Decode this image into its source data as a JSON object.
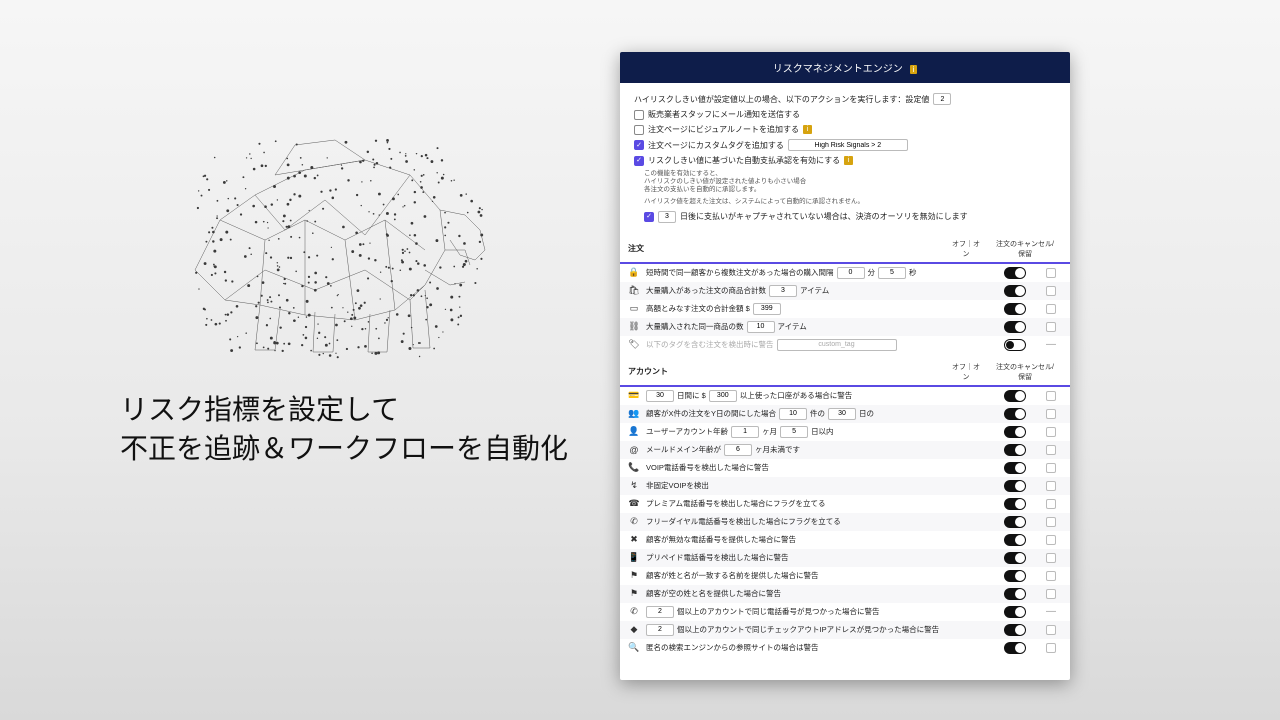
{
  "promo": {
    "line1": "リスク指標を設定して",
    "line2": "不正を追跡＆ワークフローを自動化"
  },
  "panel": {
    "title": "リスクマネジメントエンジン",
    "intro": {
      "threshold_prefix": "ハイリスクしきい値が設定値以上の場合、以下のアクションを実行します：設定値",
      "threshold_value": "2",
      "opt_mail": "販売業者スタッフにメール通知を送信する",
      "opt_visual": "注文ページにビジュアルノートを追加する",
      "opt_tag": "注文ページにカスタムタグを追加する",
      "tag_value": "High Risk Signals > 2",
      "opt_autopay": "リスクしきい値に基づいた自動支払承認を有効にする",
      "note1": "この機能を有効にすると、",
      "note2": "ハイリスクのしきい値が設定された値よりも小さい場合",
      "note3": "各注文の支払いを自動的に承認します。",
      "note4": "ハイリスク値を超えた注文は、システムによって自動的に承認されません。",
      "void_days": "3",
      "void_text": "日後に支払いがキャプチャされていない場合は、決済のオーソリを無効にします"
    },
    "sections": {
      "order": {
        "title": "注文",
        "col_toggle": "オフ｜オン",
        "col_cancel": "注文のキャンセル/保留"
      },
      "account": {
        "title": "アカウント",
        "col_toggle": "オフ｜オン",
        "col_cancel": "注文のキャンセル/保留"
      }
    },
    "order_rules": [
      {
        "ico": "🔒",
        "pre": "短時間で同一顧客から複数注文があった場合の購入間隔",
        "a": "0",
        "mid": "分",
        "b": "5",
        "post": "秒",
        "toggle": "on",
        "cancel": "box"
      },
      {
        "ico": "🛍",
        "pre": "大量購入があった注文の商品合計数",
        "a": "3",
        "post": "アイテム",
        "toggle": "on",
        "cancel": "box"
      },
      {
        "ico": "▭",
        "pre": "高額とみなす注文の合計金額 $",
        "a": "399",
        "toggle": "on",
        "cancel": "box"
      },
      {
        "ico": "⛓",
        "pre": "大量購入された同一商品の数",
        "a": "10",
        "post": "アイテム",
        "toggle": "on",
        "cancel": "box"
      },
      {
        "ico": "🏷",
        "pre": "以下のタグを含む注文を検出時に警告",
        "a": "custom_tag",
        "wide": true,
        "toggle": "off",
        "cancel": "dash",
        "disabled": true
      }
    ],
    "account_rules": [
      {
        "ico": "💳",
        "a": "30",
        "mid": "日間に $",
        "b": "300",
        "post": "以上使った口座がある場合に警告",
        "toggle": "on",
        "cancel": "box"
      },
      {
        "ico": "👥",
        "pre": "顧客がX件の注文をY日の間にした場合",
        "a": "10",
        "mid": "件の",
        "b": "30",
        "post": "日の",
        "toggle": "on",
        "cancel": "box"
      },
      {
        "ico": "👤",
        "pre": "ユーザーアカウント年齢",
        "a": "1",
        "mid": "ヶ月",
        "b": "5",
        "post": "日以内",
        "toggle": "on",
        "cancel": "box"
      },
      {
        "ico": "@",
        "pre": "メールドメイン年齢が",
        "a": "6",
        "post": "ヶ月未満です",
        "toggle": "on",
        "cancel": "box"
      },
      {
        "ico": "📞",
        "pre": "VOIP電話番号を検出した場合に警告",
        "toggle": "on",
        "cancel": "box"
      },
      {
        "ico": "↯",
        "pre": "非固定VOIPを検出",
        "toggle": "on",
        "cancel": "box"
      },
      {
        "ico": "☎",
        "pre": "プレミアム電話番号を検出した場合にフラグを立てる",
        "toggle": "on",
        "cancel": "box"
      },
      {
        "ico": "✆",
        "pre": "フリーダイヤル電話番号を検出した場合にフラグを立てる",
        "toggle": "on",
        "cancel": "box"
      },
      {
        "ico": "✖",
        "pre": "顧客が無効な電話番号を提供した場合に警告",
        "toggle": "on",
        "cancel": "box"
      },
      {
        "ico": "📱",
        "pre": "プリペイド電話番号を検出した場合に警告",
        "toggle": "on",
        "cancel": "box"
      },
      {
        "ico": "⚑",
        "pre": "顧客が姓と名が一致する名前を提供した場合に警告",
        "toggle": "on",
        "cancel": "box"
      },
      {
        "ico": "⚑",
        "pre": "顧客が空の姓と名を提供した場合に警告",
        "toggle": "on",
        "cancel": "box"
      },
      {
        "ico": "✆",
        "a": "2",
        "post": "個以上のアカウントで同じ電話番号が見つかった場合に警告",
        "toggle": "on",
        "cancel": "dash"
      },
      {
        "ico": "◆",
        "a": "2",
        "post": "個以上のアカウントで同じチェックアウトIPアドレスが見つかった場合に警告",
        "toggle": "on",
        "cancel": "box"
      },
      {
        "ico": "🔍",
        "pre": "匿名の検索エンジンからの参照サイトの場合は警告",
        "toggle": "on",
        "cancel": "box"
      }
    ]
  }
}
